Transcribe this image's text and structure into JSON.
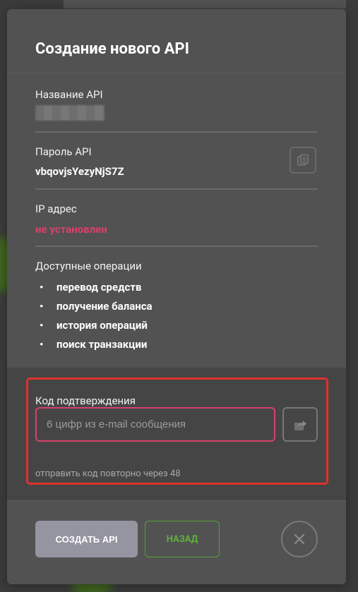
{
  "modal": {
    "title": "Создание нового API",
    "api_name": {
      "label": "Название API"
    },
    "api_password": {
      "label": "Пароль API",
      "value": "vbqovjsYezyNjS7Z",
      "copy_icon": "copy-icon"
    },
    "ip": {
      "label": "IP адрес",
      "value": "не установлен"
    },
    "operations": {
      "label": "Доступные операции",
      "items": [
        "перевод средств",
        "получение баланса",
        "история операций",
        "поиск транзакции"
      ]
    },
    "confirmation": {
      "label": "Код подтверждения",
      "input_placeholder": "6 цифр из e-mail сообщения",
      "input_value": "",
      "send_icon": "send-icon",
      "resend_text": "отправить код повторно через 48"
    },
    "footer": {
      "create_label": "СОЗДАТЬ API",
      "back_label": "НАЗАД",
      "close_icon": "close-icon"
    }
  },
  "colors": {
    "accent_pink": "#d8416a",
    "accent_green": "#5fb23a",
    "highlight_red": "#e0312d",
    "create_button": "#9595a2"
  }
}
